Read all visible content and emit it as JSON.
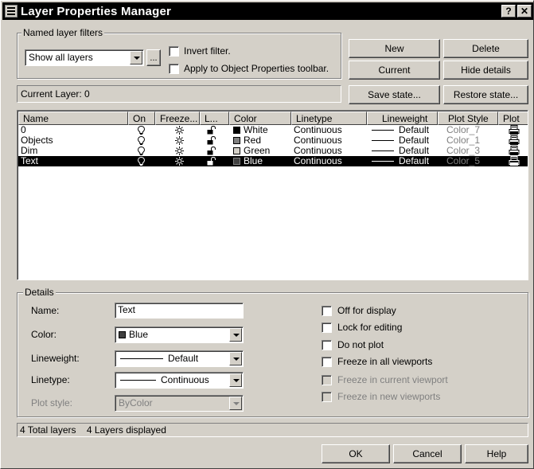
{
  "window": {
    "title": "Layer Properties Manager",
    "help_btn": "?",
    "close_btn": "✕"
  },
  "filters": {
    "group_label": "Named layer filters",
    "selected": "Show all layers",
    "ellipsis": "...",
    "invert_label": "Invert filter.",
    "apply_label": "Apply to Object Properties toolbar."
  },
  "buttons": {
    "new": "New",
    "delete": "Delete",
    "current": "Current",
    "hide_details": "Hide details",
    "save_state": "Save state...",
    "restore_state": "Restore state...",
    "ok": "OK",
    "cancel": "Cancel",
    "help": "Help"
  },
  "current_layer": "Current Layer: 0",
  "columns": [
    "Name",
    "On",
    "Freeze...",
    "L...",
    "Color",
    "Linetype",
    "Lineweight",
    "Plot Style",
    "Plot"
  ],
  "layers": [
    {
      "name": "0",
      "color": "White",
      "color_hex": "#000000",
      "linetype": "Continuous",
      "lineweight": "Default",
      "plot_style": "Color_7"
    },
    {
      "name": "Objects",
      "color": "Red",
      "color_hex": "#808080",
      "linetype": "Continuous",
      "lineweight": "Default",
      "plot_style": "Color_1"
    },
    {
      "name": "Dim",
      "color": "Green",
      "color_hex": "#d4d0c8",
      "linetype": "Continuous",
      "lineweight": "Default",
      "plot_style": "Color_3"
    },
    {
      "name": "Text",
      "color": "Blue",
      "color_hex": "#404040",
      "linetype": "Continuous",
      "lineweight": "Default",
      "plot_style": "Color_5"
    }
  ],
  "details": {
    "group_label": "Details",
    "name_label": "Name:",
    "name_value": "Text",
    "color_label": "Color:",
    "color_value": "Blue",
    "lineweight_label": "Lineweight:",
    "lineweight_value": "Default",
    "linetype_label": "Linetype:",
    "linetype_value": "Continuous",
    "plotstyle_label": "Plot style:",
    "plotstyle_value": "ByColor",
    "off_display": "Off for display",
    "lock_editing": "Lock for editing",
    "do_not_plot": "Do not plot",
    "freeze_all": "Freeze in all viewports",
    "freeze_current": "Freeze in current viewport",
    "freeze_new": "Freeze in new viewports"
  },
  "status": {
    "total": "4 Total layers",
    "displayed": "4 Layers displayed"
  }
}
